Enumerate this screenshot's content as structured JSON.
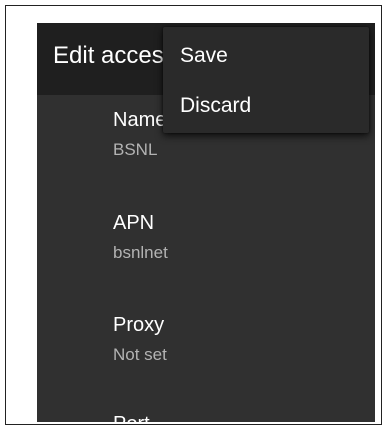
{
  "app_bar": {
    "title": "Edit access point"
  },
  "preferences": [
    {
      "title": "Name",
      "summary": "BSNL"
    },
    {
      "title": "APN",
      "summary": "bsnlnet"
    },
    {
      "title": "Proxy",
      "summary": "Not set"
    },
    {
      "title": "Port",
      "summary": ""
    }
  ],
  "overflow_menu": {
    "items": [
      {
        "label": "Save"
      },
      {
        "label": "Discard"
      }
    ]
  },
  "colors": {
    "app_bar_background": "#1f1f1f",
    "screen_background": "#303030",
    "menu_background": "#2a2a2a",
    "primary_text": "#ffffff",
    "secondary_text": "#b3b3b3"
  }
}
